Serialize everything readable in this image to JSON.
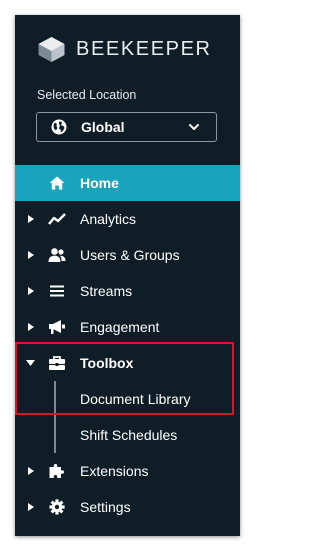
{
  "brand": {
    "name": "BEEKEEPER"
  },
  "location": {
    "label": "Selected Location",
    "value": "Global"
  },
  "nav": {
    "home": "Home",
    "analytics": "Analytics",
    "users_groups": "Users & Groups",
    "streams": "Streams",
    "engagement": "Engagement",
    "toolbox": "Toolbox",
    "toolbox_items": [
      "Document Library",
      "Shift Schedules"
    ],
    "extensions": "Extensions",
    "settings": "Settings"
  },
  "colors": {
    "sidebar_bg": "#0f1d27",
    "active_bg": "#1aa3bd",
    "highlight_border": "#d3172e"
  },
  "icons": {
    "home": "home-icon",
    "analytics": "line-chart-icon",
    "users_groups": "users-icon",
    "streams": "list-icon",
    "engagement": "megaphone-icon",
    "toolbox": "toolbox-icon",
    "extensions": "puzzle-icon",
    "settings": "gear-icon"
  }
}
